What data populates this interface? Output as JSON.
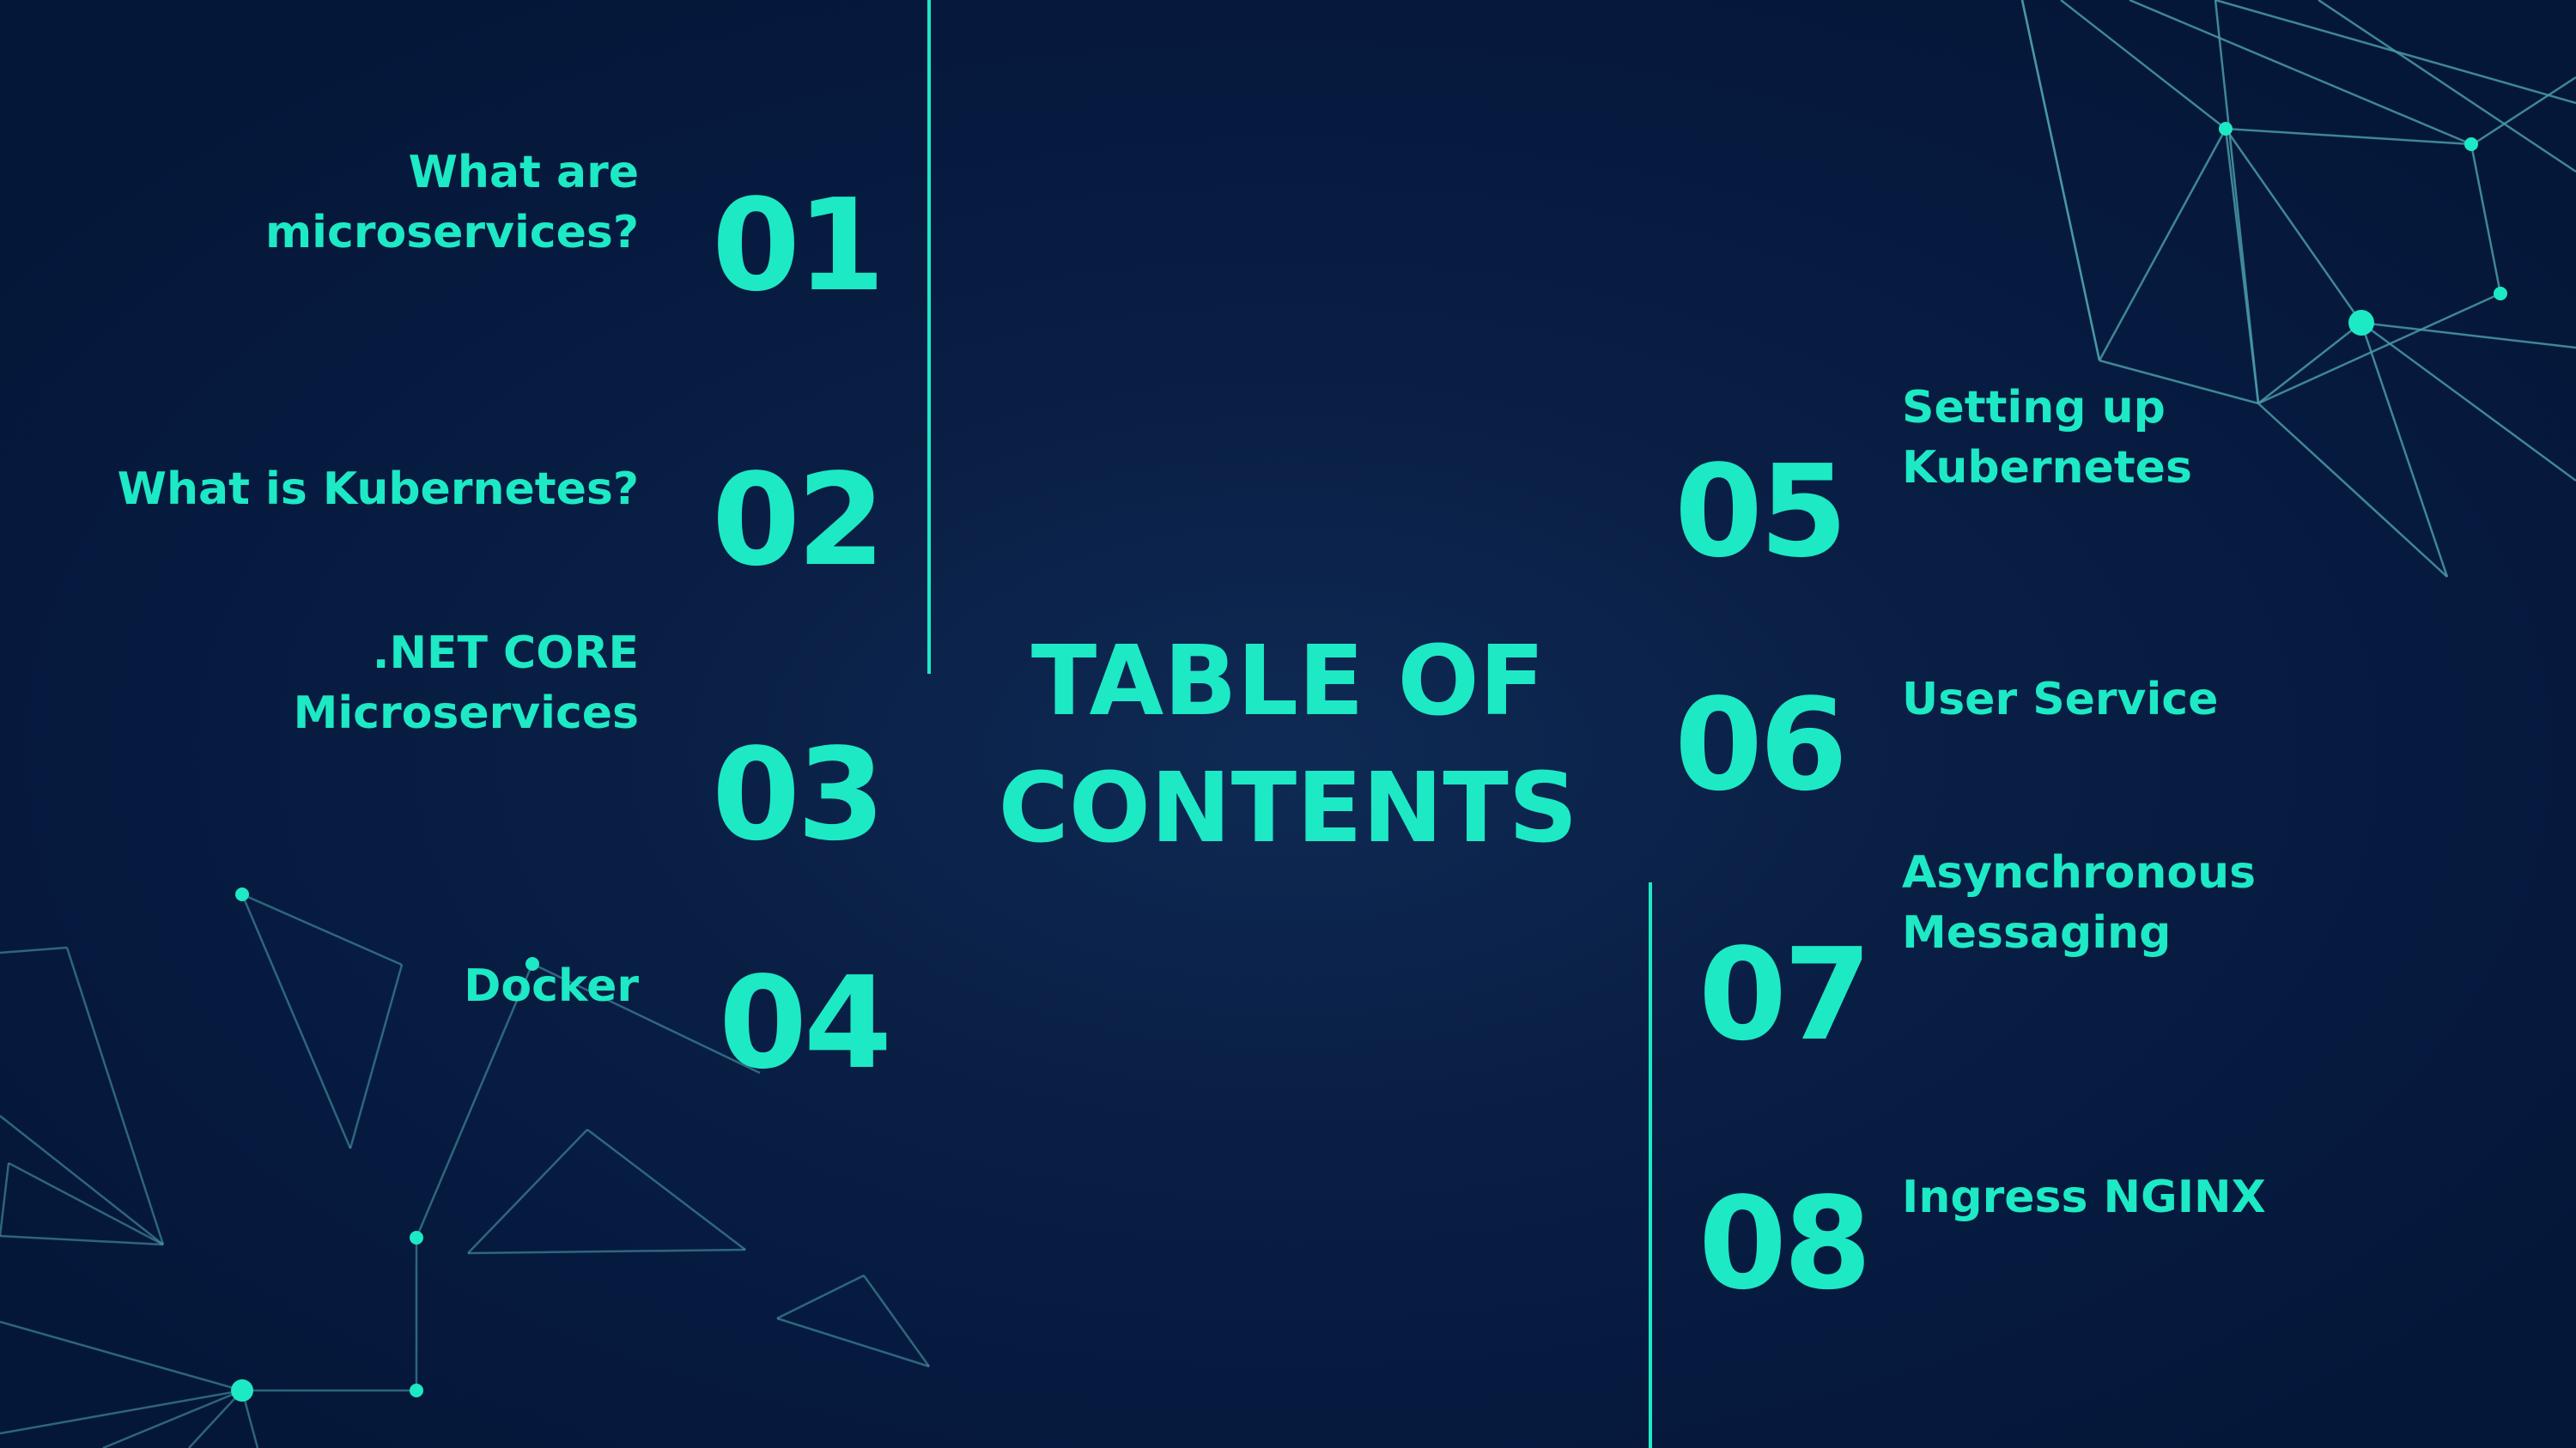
{
  "colors": {
    "accent": "#1de9c5",
    "line": "#4a9aa8",
    "background": "#061a3f"
  },
  "title": {
    "line1": "TABLE OF",
    "line2": "CONTENTS"
  },
  "items": [
    {
      "number": "01",
      "label": [
        "What are",
        "microservices?"
      ]
    },
    {
      "number": "02",
      "label": [
        "What is Kubernetes?"
      ]
    },
    {
      "number": "03",
      "label": [
        ".NET CORE",
        "Microservices"
      ]
    },
    {
      "number": "04",
      "label": [
        "Docker"
      ]
    },
    {
      "number": "05",
      "label": [
        "Setting up",
        "Kubernetes"
      ]
    },
    {
      "number": "06",
      "label": [
        "User Service"
      ]
    },
    {
      "number": "07",
      "label": [
        "Asynchronous",
        "Messaging"
      ]
    },
    {
      "number": "08",
      "label": [
        "Ingress NGINX"
      ]
    }
  ]
}
